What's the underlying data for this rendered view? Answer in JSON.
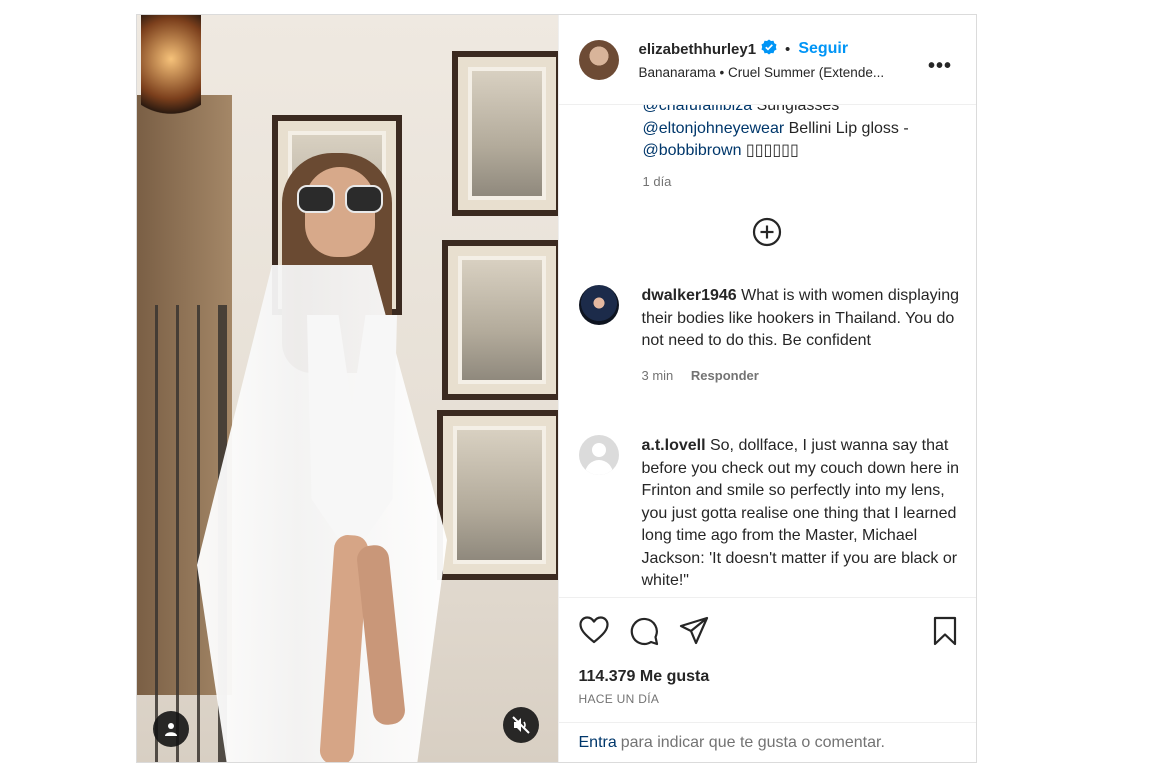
{
  "post": {
    "author": {
      "username": "elizabethhurley1",
      "verified": true,
      "follow_label": "Seguir",
      "separator": "•",
      "audio": "Bananarama • Cruel Summer (Extende..."
    },
    "more_label": "•••",
    "caption": {
      "line1_tag": "@chafufalfibiza",
      "line1_text": " Sunglasses",
      "line2_tag": "@eltonjohneyewear",
      "line2_text": " Bellini Lip gloss -",
      "line3_tag": "@bobbibrown",
      "line3_text": " ▯▯▯▯▯▯",
      "time": "1 día"
    },
    "comments": [
      {
        "username": "dwalker1946",
        "text": "What is with women displaying their bodies like hookers in Thailand. You do not need to do this. Be confident",
        "time": "3 min",
        "reply_label": "Responder"
      },
      {
        "username": "a.t.lovell",
        "text": "So, dollface, I just wanna say that before you check out my couch down here in Frinton and smile so perfectly into my lens, you just gotta realise one thing that I learned long time ago from the Master, Michael Jackson: 'It doesn't matter if you are black or white!\""
      }
    ],
    "likes": "114.379 Me gusta",
    "posted": "HACE UN DÍA",
    "add_comment": {
      "link": "Entra",
      "text": "para indicar que te gusta o comentar."
    }
  },
  "colors": {
    "accent": "#0095f6",
    "link": "#00376b",
    "muted": "#737373",
    "text": "#262626",
    "border": "#dbdbdb"
  },
  "icons": [
    "verified-badge-icon",
    "add-comments-icon",
    "heart-icon",
    "comment-icon",
    "share-icon",
    "bookmark-icon",
    "user-tag-icon",
    "mute-icon",
    "more-options-icon"
  ]
}
